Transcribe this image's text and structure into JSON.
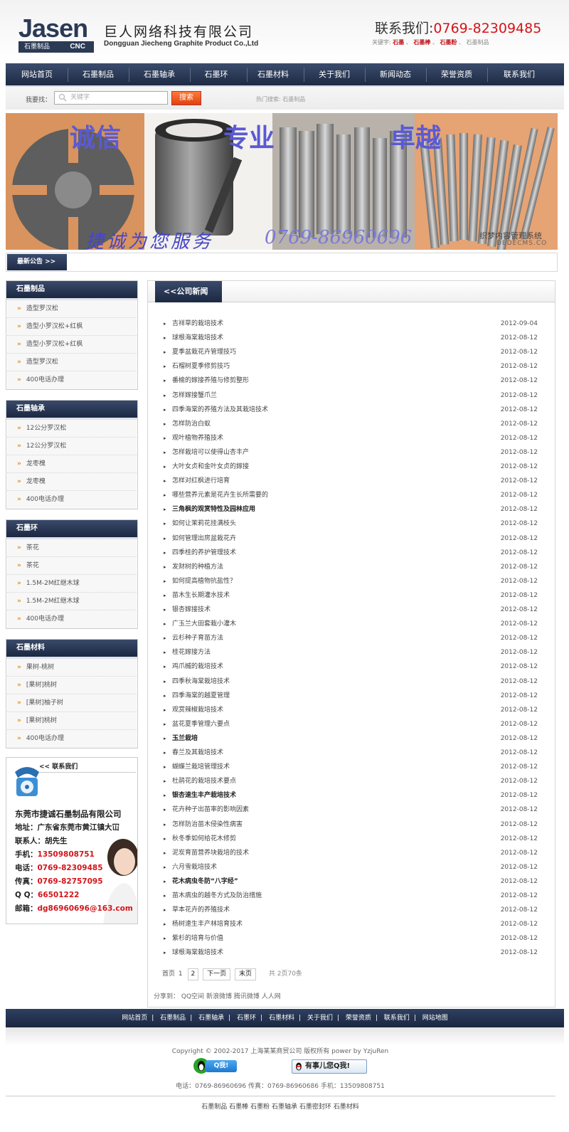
{
  "header": {
    "logo_text": "Jasen",
    "logo_sub_cn": "石墨制品",
    "logo_sub_en": "CNC",
    "company_name_cn": "巨人网络科技有限公司",
    "company_name_en": "Dongguan Jiecheng Graphite Product Co.,Ltd",
    "contact_label": "联系我们:",
    "contact_phone": "0769-82309485",
    "keywords_label": "关键字:",
    "keywords": [
      "石墨",
      "石墨棒",
      "石墨粉",
      "石墨制品"
    ]
  },
  "nav": {
    "items": [
      "网站首页",
      "石墨制品",
      "石墨轴承",
      "石墨环",
      "石墨材料",
      "关于我们",
      "新闻动态",
      "荣誉资质",
      "联系我们"
    ]
  },
  "search": {
    "label": "我要找：",
    "placeholder": "关键字",
    "button": "搜索",
    "hot_label": "热门搜索:",
    "hot_term": "石墨制品"
  },
  "banner": {
    "words": [
      "诚信",
      "专业",
      "卓越"
    ],
    "slogan": "捷诚为您服务",
    "phone": "0769-86960696",
    "watermark_cn": "织梦内容管理系统",
    "watermark_en": "DEDECMS.CO"
  },
  "notice": {
    "label": "最新公告 >>"
  },
  "sidebar": {
    "boxes": [
      {
        "title": "石墨制品",
        "items": [
          "造型罗汉松",
          "造型小罗汉松+红枫",
          "造型小罗汉松+红枫",
          "造型罗汉松",
          "400电话办理"
        ]
      },
      {
        "title": "石墨轴承",
        "items": [
          "12公分罗汉松",
          "12公分罗汉松",
          "龙枣槐",
          "龙枣槐",
          "400电话办理"
        ]
      },
      {
        "title": "石墨环",
        "items": [
          "茶花",
          "茶花",
          "1.5M-2M红继木球",
          "1.5M-2M红继木球",
          "400电话办理"
        ]
      },
      {
        "title": "石墨材料",
        "items": [
          "果树-桃树",
          "[果树]桃树",
          "[果树]柚子树",
          "[果树]桃树",
          "400电话办理"
        ]
      }
    ],
    "contact": {
      "title": "<< 联系我们",
      "company": "东莞市捷诚石墨制品有限公司",
      "address_label": "地址：",
      "address": "广东省东莞市黄江镇大冚",
      "person_label": "联系人：",
      "person": "胡先生",
      "mobile_label": "手机：",
      "mobile": "13509808751",
      "tel_label": "电话：",
      "tel": "0769-82309485",
      "fax_label": "传真：",
      "fax": "0769-82757095",
      "qq_label": "Q Q：",
      "qq": "66501222",
      "email_label": "邮箱：",
      "email": "dg86960696@163.com"
    }
  },
  "main": {
    "tab": "<<公司新闻",
    "news": [
      {
        "title": "吉祥草的栽培技术",
        "date": "2012-09-04",
        "bold": false
      },
      {
        "title": "球根海棠栽培技术",
        "date": "2012-08-12",
        "bold": false
      },
      {
        "title": "夏季盆栽花卉管理技巧",
        "date": "2012-08-12",
        "bold": false
      },
      {
        "title": "石榴树夏季修剪技巧",
        "date": "2012-08-12",
        "bold": false
      },
      {
        "title": "番榆的嫁接养殖与修剪整形",
        "date": "2012-08-12",
        "bold": false
      },
      {
        "title": "怎样嫁接蟹爪兰",
        "date": "2012-08-12",
        "bold": false
      },
      {
        "title": "四季海棠的养殖方法及其栽培技术",
        "date": "2012-08-12",
        "bold": false
      },
      {
        "title": "怎样防治白蚁",
        "date": "2012-08-12",
        "bold": false
      },
      {
        "title": "观叶植物养殖技术",
        "date": "2012-08-12",
        "bold": false
      },
      {
        "title": "怎样栽培可以使得山杏丰产",
        "date": "2012-08-12",
        "bold": false
      },
      {
        "title": "大叶女贞和金叶女贞的嫁接",
        "date": "2012-08-12",
        "bold": false
      },
      {
        "title": "怎样对红枫进行培育",
        "date": "2012-08-12",
        "bold": false
      },
      {
        "title": "哪些营养元素是花卉生长所需要的",
        "date": "2012-08-12",
        "bold": false
      },
      {
        "title": "三角枫的观赏特性及园林应用",
        "date": "2012-08-12",
        "bold": true
      },
      {
        "title": "如何让茉莉花挂满枝头",
        "date": "2012-08-12",
        "bold": false
      },
      {
        "title": "如何管理出房盆栽花卉",
        "date": "2012-08-12",
        "bold": false
      },
      {
        "title": "四季桂的养护管理技术",
        "date": "2012-08-12",
        "bold": false
      },
      {
        "title": "发财树的种植方法",
        "date": "2012-08-12",
        "bold": false
      },
      {
        "title": "如何提高植物抗盐性？",
        "date": "2012-08-12",
        "bold": false
      },
      {
        "title": "苗木生长期灌水技术",
        "date": "2012-08-12",
        "bold": false
      },
      {
        "title": "银杏嫁接技术",
        "date": "2012-08-12",
        "bold": false
      },
      {
        "title": "广玉兰大田套栽小灌木",
        "date": "2012-08-12",
        "bold": false
      },
      {
        "title": "云杉种子育苗方法",
        "date": "2012-08-12",
        "bold": false
      },
      {
        "title": "桂花嫁接方法",
        "date": "2012-08-12",
        "bold": false
      },
      {
        "title": "鸡爪槭的栽培技术",
        "date": "2012-08-12",
        "bold": false
      },
      {
        "title": "四季秋海棠栽培技术",
        "date": "2012-08-12",
        "bold": false
      },
      {
        "title": "四季海棠的越夏管理",
        "date": "2012-08-12",
        "bold": false
      },
      {
        "title": "观赏辣椒栽培技术",
        "date": "2012-08-12",
        "bold": false
      },
      {
        "title": "盆花夏季管理六要点",
        "date": "2012-08-12",
        "bold": false
      },
      {
        "title": "玉兰栽培",
        "date": "2012-08-12",
        "bold": true
      },
      {
        "title": "春兰及其栽培技术",
        "date": "2012-08-12",
        "bold": false
      },
      {
        "title": "蝴蝶兰栽培管理技术",
        "date": "2012-08-12",
        "bold": false
      },
      {
        "title": "杜鹃花的栽培技术要点",
        "date": "2012-08-12",
        "bold": false
      },
      {
        "title": "银杏速生丰产栽培技术",
        "date": "2012-08-12",
        "bold": true
      },
      {
        "title": "花卉种子出苗率的影响因素",
        "date": "2012-08-12",
        "bold": false
      },
      {
        "title": "怎样防治苗木侵染性病害",
        "date": "2012-08-12",
        "bold": false
      },
      {
        "title": "秋冬季如何给花木修剪",
        "date": "2012-08-12",
        "bold": false
      },
      {
        "title": "泥炭育苗营养块栽培的技术",
        "date": "2012-08-12",
        "bold": false
      },
      {
        "title": "六月雪栽培技术",
        "date": "2012-08-12",
        "bold": false
      },
      {
        "title": "花木病虫冬防“八字经”",
        "date": "2012-08-12",
        "bold": true
      },
      {
        "title": "苗木病虫的越冬方式及防治措施",
        "date": "2012-08-12",
        "bold": false
      },
      {
        "title": "草本花卉的养殖技术",
        "date": "2012-08-12",
        "bold": false
      },
      {
        "title": "杨树速生丰产林培育技术",
        "date": "2012-08-12",
        "bold": false
      },
      {
        "title": "紫杉的培育与价值",
        "date": "2012-08-12",
        "bold": false
      },
      {
        "title": "球根海棠栽培技术",
        "date": "2012-08-12",
        "bold": false
      }
    ],
    "pager": {
      "first": "首页",
      "current": "1",
      "page2": "2",
      "next": "下一页",
      "last": "末页",
      "summary": "共 2页70条"
    },
    "share": {
      "label": "分享到：",
      "targets": [
        "QQ空间",
        "新浪微博",
        "腾讯微博",
        "人人网"
      ]
    }
  },
  "footer": {
    "nav": [
      "网站首页",
      "石墨制品",
      "石墨轴承",
      "石墨环",
      "石墨材料",
      "关于我们",
      "荣誉资质",
      "联系我们",
      "网站地图"
    ],
    "copyright": "Copyright © 2002-2017 上海某某商贸公司 版权所有 power by YzjuRen",
    "qq_btn1": "Q我!",
    "qq_btn2": "有事儿您Q我!",
    "phones": "电话：0769-86960696 传真：0769-86960686 手机：13509808751",
    "links": [
      "石墨制品",
      "石墨棒",
      "石墨粉",
      "石墨轴承",
      "石墨密封环",
      "石墨材料"
    ]
  },
  "colors": {
    "nav_dark": "#1d2a44",
    "accent_red": "#d4141a",
    "arrow_orange": "#e48a1a",
    "search_button": "#e0420c"
  }
}
